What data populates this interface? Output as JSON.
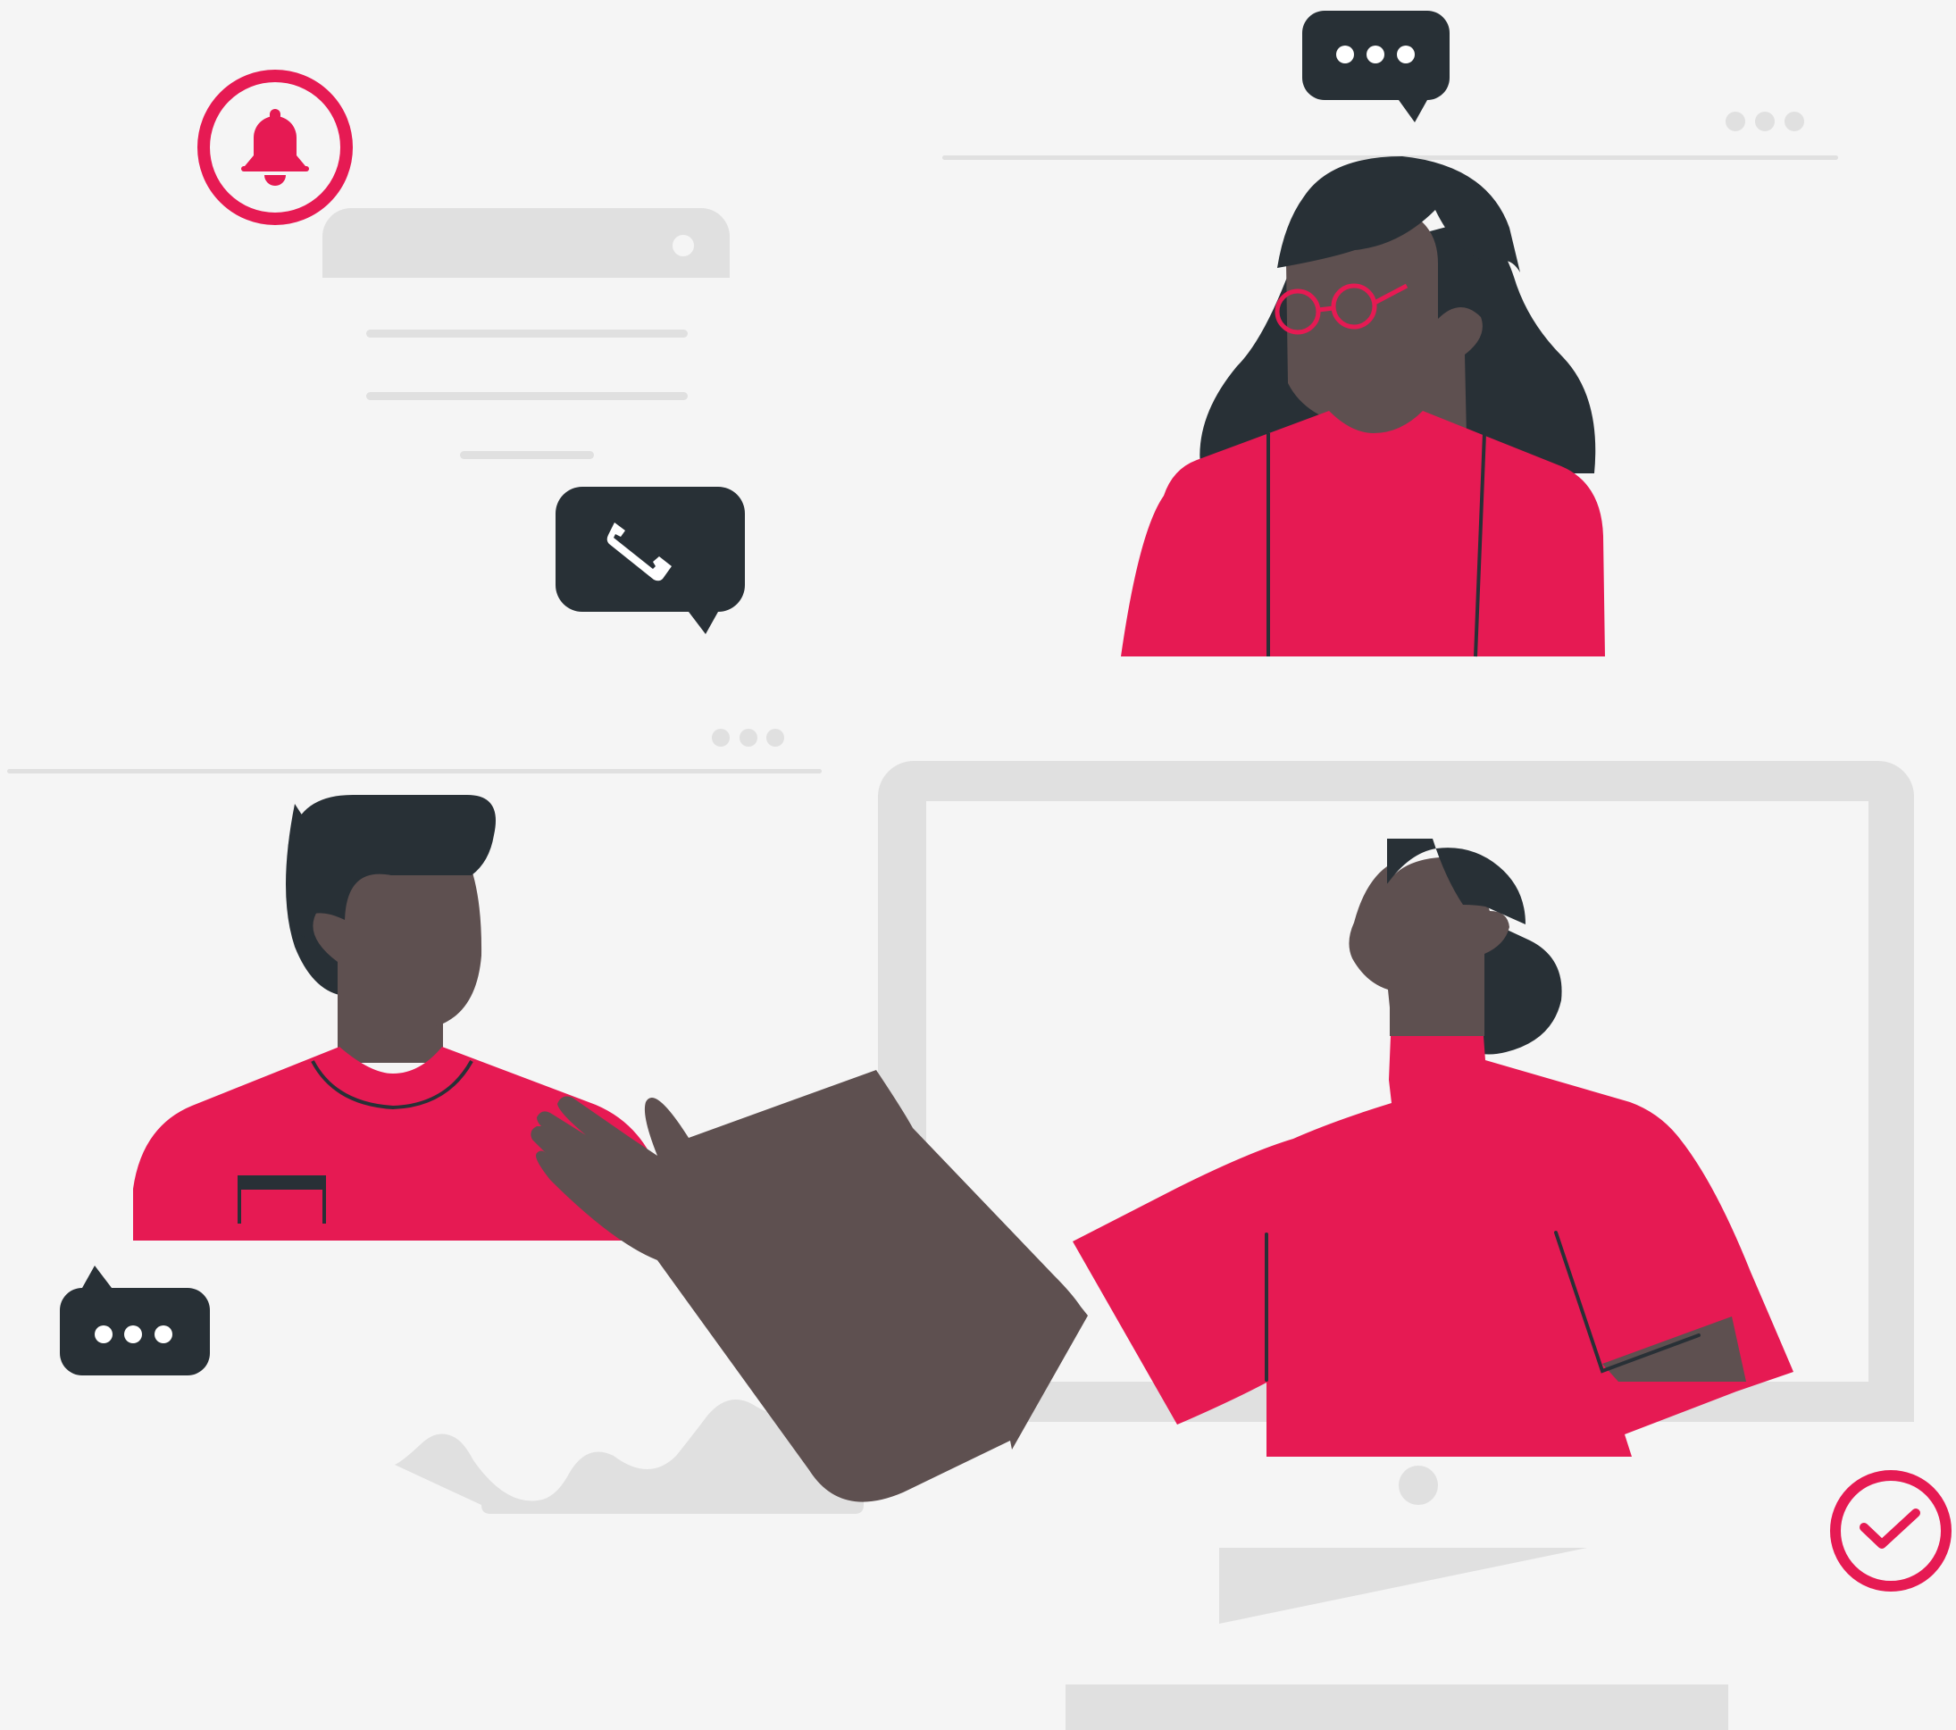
{
  "illustration": {
    "kind": "video-call",
    "participants": [
      "woman-with-glasses",
      "man",
      "presenting-woman"
    ]
  },
  "icons": {
    "notification": "bell-icon",
    "call": "phone-icon",
    "typing": "dots-icon",
    "done": "check-icon"
  },
  "colors": {
    "background": "#f5f5f5",
    "accent": "#e61a53",
    "dark": "#283036",
    "skin": "#5e5050",
    "placeholder": "#e0e0e0"
  }
}
